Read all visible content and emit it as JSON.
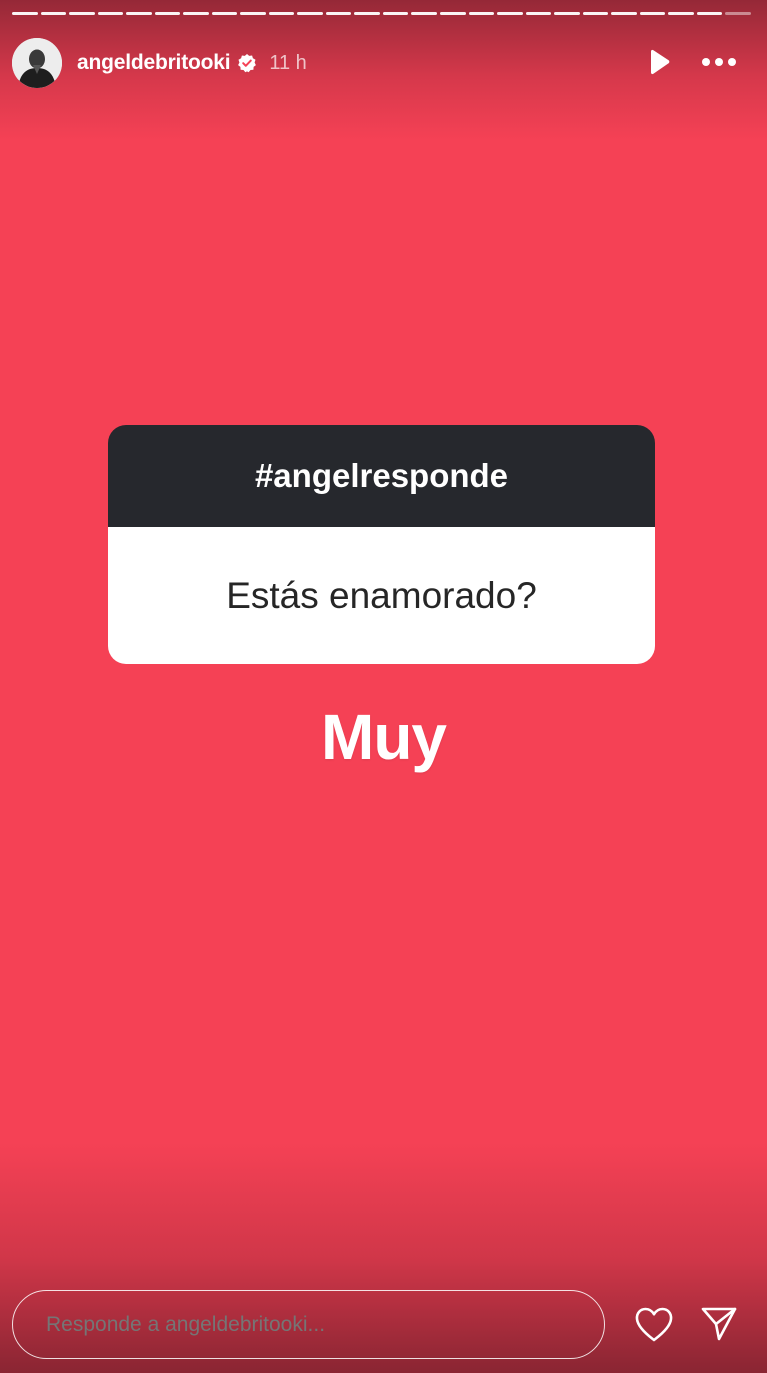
{
  "story": {
    "background_color": "#f54155",
    "segments_total": 26,
    "segments_viewed": 25
  },
  "header": {
    "username": "angeldebritooki",
    "verified_icon": "verified-badge-icon",
    "time_ago": "11 h",
    "play_icon": "play-icon",
    "more_icon": "more-options-icon",
    "avatar_icon": "profile-avatar"
  },
  "sticker": {
    "title": "#angelresponde",
    "question": "Estás enamorado?"
  },
  "answer_text": "Muy",
  "footer": {
    "reply_placeholder": "Responde a angeldebritooki...",
    "like_icon": "heart-icon",
    "send_icon": "send-icon"
  }
}
